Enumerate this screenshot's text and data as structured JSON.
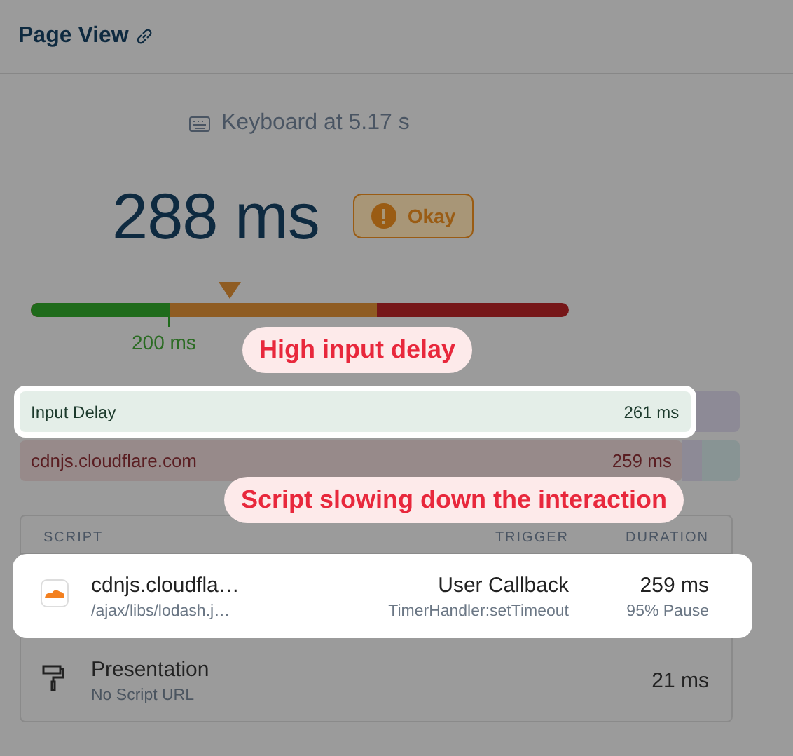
{
  "header": {
    "title": "Page View"
  },
  "interaction": {
    "label": "Keyboard at 5.17 s"
  },
  "value": "288 ms",
  "rating": {
    "label": "Okay",
    "kind": "okay"
  },
  "scale": {
    "level": 0.37,
    "threshold_label": "200 ms"
  },
  "breakdown": [
    {
      "label": "Input Delay",
      "value": "261 ms",
      "kind": "input",
      "highlighted": true
    },
    {
      "label": "cdnjs.cloudflare.com",
      "value": "259 ms",
      "kind": "script",
      "highlighted": false
    }
  ],
  "table": {
    "columns": [
      "SCRIPT",
      "TRIGGER",
      "DURATION"
    ],
    "rows": [
      {
        "kind": "cloud",
        "name": "cdnjs.cloudfla…",
        "url": "/ajax/libs/lodash.j…",
        "trigger": "User Callback",
        "trigger_detail": "TimerHandler:setTimeout",
        "duration": "259 ms",
        "duration_detail": "95% Pause",
        "highlighted": true
      },
      {
        "kind": "roller",
        "name": "Presentation",
        "url": "No Script URL",
        "duration": "21 ms",
        "highlighted": false
      }
    ]
  },
  "callouts": [
    {
      "text": "High input delay"
    },
    {
      "text": "Script slowing down the interaction"
    }
  ]
}
